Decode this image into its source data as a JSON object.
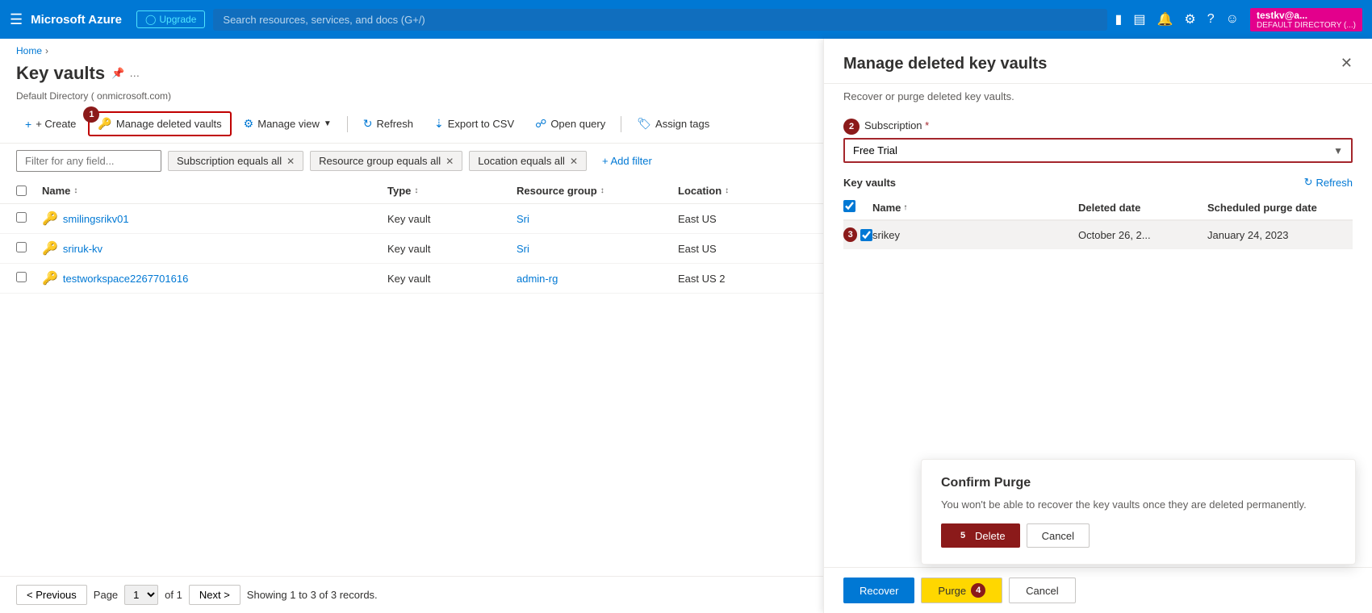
{
  "topnav": {
    "logo": "Microsoft Azure",
    "upgrade_label": "Upgrade",
    "search_placeholder": "Search resources, services, and docs (G+/)",
    "user": {
      "name": "testkv@a...",
      "directory": "DEFAULT DIRECTORY (...)"
    }
  },
  "breadcrumb": {
    "home": "Home",
    "current": ""
  },
  "page": {
    "title": "Key vaults",
    "directory_info": "Default Directory (               onmicrosoft.com)"
  },
  "toolbar": {
    "create_label": "+ Create",
    "manage_deleted_label": "Manage deleted vaults",
    "manage_view_label": "Manage view",
    "refresh_label": "Refresh",
    "export_csv_label": "Export to CSV",
    "open_query_label": "Open query",
    "assign_tags_label": "Assign tags"
  },
  "filters": {
    "placeholder": "Filter for any field...",
    "subscription_filter": "Subscription equals all",
    "resource_group_filter": "Resource group equals all",
    "location_filter": "Location equals all",
    "add_filter_label": "+ Add filter"
  },
  "table": {
    "columns": [
      "Name",
      "Type",
      "Resource group",
      "Location"
    ],
    "rows": [
      {
        "name": "smilingsrikv01",
        "type": "Key vault",
        "resource_group": "Sri",
        "location": "East US"
      },
      {
        "name": "sriruk-kv",
        "type": "Key vault",
        "resource_group": "Sri",
        "location": "East US"
      },
      {
        "name": "testworkspace2267701616",
        "type": "Key vault",
        "resource_group": "admin-rg",
        "location": "East US 2"
      }
    ]
  },
  "pagination": {
    "previous_label": "< Previous",
    "next_label": "Next >",
    "page_label": "Page",
    "of_label": "of 1",
    "records_text": "Showing 1 to 3 of 3 records.",
    "page_value": "1"
  },
  "panel": {
    "title": "Manage deleted key vaults",
    "subtitle": "Recover or purge deleted key vaults.",
    "subscription_label": "Subscription",
    "subscription_value": "Free Trial",
    "kv_section_title": "Key vaults",
    "refresh_label": "Refresh",
    "table_cols": [
      "Name",
      "Deleted date",
      "Scheduled purge date"
    ],
    "rows": [
      {
        "name": "srikey",
        "deleted_date": "October 26, 2...",
        "purge_date": "January 24, 2023"
      }
    ],
    "recover_label": "Recover",
    "purge_label": "Purge",
    "cancel_label": "Cancel"
  },
  "confirm_purge": {
    "title": "Confirm Purge",
    "text": "You won't be able to recover the key vaults once they are deleted permanently.",
    "delete_label": "Delete",
    "cancel_label": "Cancel"
  },
  "badges": {
    "step1": "1",
    "step2": "2",
    "step3": "3",
    "step4": "4",
    "step5": "5"
  }
}
